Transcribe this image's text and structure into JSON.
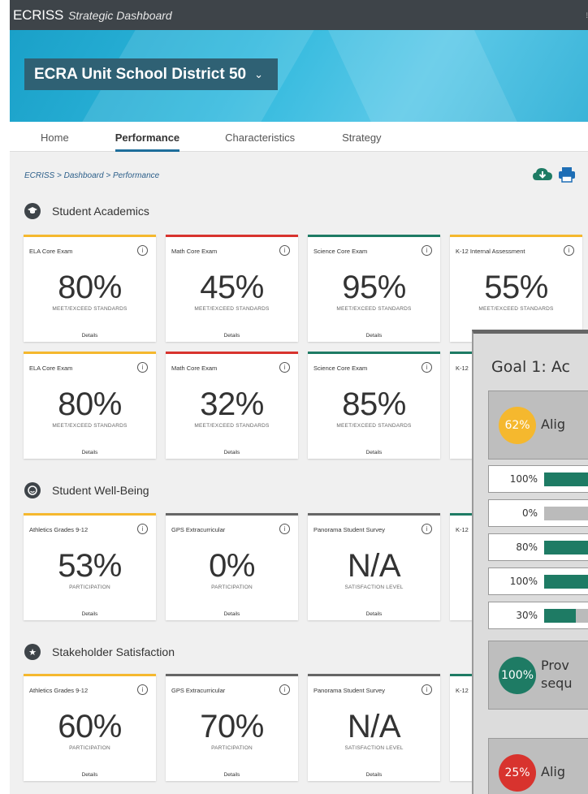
{
  "app": {
    "name": "ECRISS",
    "subtitle": "Strategic Dashboard"
  },
  "district": {
    "label": "ECRA Unit School District 50",
    "chevron_icon": "chevron-down-icon"
  },
  "tabs": [
    {
      "label": "Home",
      "active": false
    },
    {
      "label": "Performance",
      "active": true
    },
    {
      "label": "Characteristics",
      "active": false
    },
    {
      "label": "Strategy",
      "active": false
    }
  ],
  "breadcrumb": "ECRISS > Dashboard > Performance",
  "toolbar": {
    "download_icon": "cloud-download-icon",
    "print_icon": "printer-icon"
  },
  "sections": [
    {
      "title": "Student Academics",
      "icon": "graduation-cap-icon"
    },
    {
      "title": "Student Well-Being",
      "icon": "smiley-icon"
    },
    {
      "title": "Stakeholder Satisfaction",
      "icon": "star-icon"
    }
  ],
  "colors": {
    "yellow": "#f5b82e",
    "red": "#d8332e",
    "green": "#1e7b64",
    "gray": "#666666",
    "navy": "#2f6174"
  },
  "cards": [
    {
      "name": "ELA Core Exam",
      "value": "80%",
      "sub": "MEET/EXCEED STANDARDS",
      "details": "Details",
      "color": "#f5b82e"
    },
    {
      "name": "Math Core Exam",
      "value": "45%",
      "sub": "MEET/EXCEED STANDARDS",
      "details": "Details",
      "color": "#d8332e"
    },
    {
      "name": "Science Core Exam",
      "value": "95%",
      "sub": "MEET/EXCEED STANDARDS",
      "details": "Details",
      "color": "#1e7b64"
    },
    {
      "name": "K-12 Internal Assessment",
      "value": "55%",
      "sub": "MEET/EXCEED STANDARDS",
      "details": "",
      "color": "#f5b82e"
    },
    {
      "name": "ELA Core Exam",
      "value": "80%",
      "sub": "MEET/EXCEED STANDARDS",
      "details": "Details",
      "color": "#f5b82e"
    },
    {
      "name": "Math Core Exam",
      "value": "32%",
      "sub": "MEET/EXCEED STANDARDS",
      "details": "Details",
      "color": "#d8332e"
    },
    {
      "name": "Science Core Exam",
      "value": "85%",
      "sub": "MEET/EXCEED STANDARDS",
      "details": "Details",
      "color": "#1e7b64"
    },
    {
      "name": "K-12",
      "value": "",
      "sub": "",
      "details": "",
      "color": "#1e7b64"
    },
    {
      "name": "Athletics Grades 9-12",
      "value": "53%",
      "sub": "PARTICIPATION",
      "details": "Details",
      "color": "#f5b82e"
    },
    {
      "name": "GPS Extracurricular",
      "value": "0%",
      "sub": "PARTICIPATION",
      "details": "Details",
      "color": "#666666"
    },
    {
      "name": "Panorama Student Survey",
      "value": "N/A",
      "sub": "SATISFACTION LEVEL",
      "details": "Details",
      "color": "#666666"
    },
    {
      "name": "K-12",
      "value": "",
      "sub": "",
      "details": "",
      "color": "#1e7b64"
    },
    {
      "name": "Athletics Grades 9-12",
      "value": "60%",
      "sub": "PARTICIPATION",
      "details": "Details",
      "color": "#f5b82e"
    },
    {
      "name": "GPS Extracurricular",
      "value": "70%",
      "sub": "PARTICIPATION",
      "details": "Details",
      "color": "#666666"
    },
    {
      "name": "Panorama Student Survey",
      "value": "N/A",
      "sub": "SATISFACTION LEVEL",
      "details": "Details",
      "color": "#666666"
    },
    {
      "name": "K-12",
      "value": "",
      "sub": "",
      "details": "",
      "color": "#1e7b64"
    }
  ],
  "overlay": {
    "title": "Goal 1: Ac",
    "blocks": [
      {
        "pct": "62%",
        "text": "Alig",
        "color": "#f5b82e",
        "text2": ""
      },
      {
        "pct": "100%",
        "text": "Prov",
        "text2": "sequ",
        "color": "#1e7b64"
      },
      {
        "pct": "25%",
        "text": "Alig",
        "color": "#d8332e",
        "text2": ""
      }
    ],
    "rows": [
      {
        "label": "100%",
        "fill": 1.0
      },
      {
        "label": "0%",
        "fill": 0.0
      },
      {
        "label": "80%",
        "fill": 0.8
      },
      {
        "label": "100%",
        "fill": 1.0
      },
      {
        "label": "30%",
        "fill": 0.55
      }
    ]
  }
}
